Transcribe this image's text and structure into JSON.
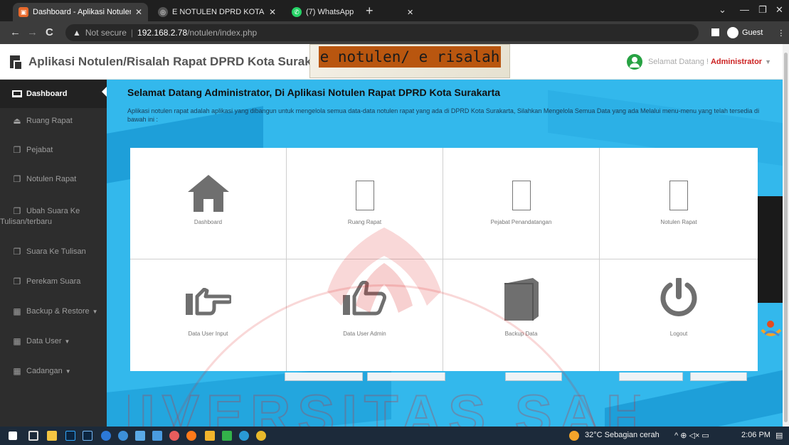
{
  "browser": {
    "tabs": [
      {
        "title": "Dashboard - Aplikasi Notulen Ra",
        "active": true,
        "favicon_color": "#e8692c"
      },
      {
        "title": "E NOTULEN DPRD KOTA SURAKA",
        "active": false,
        "favicon_color": "#8a8a8a"
      },
      {
        "title": "(7) WhatsApp",
        "active": false,
        "favicon_color": "#25d366"
      }
    ],
    "new_tab": "+",
    "address": {
      "security": "Not secure",
      "host": "192.168.2.78",
      "path": "/notulen/index.php"
    },
    "profile_label": "Guest"
  },
  "header": {
    "app_title": "Aplikasi Notulen/Risalah Rapat DPRD Kota Surakarta",
    "banner_text": "e notulen/ e risalah",
    "welcome_prefix": "Selamat Datang !",
    "user_name": "Administrator"
  },
  "sidebar": {
    "items": [
      {
        "label": "Dashboard",
        "icon": "monitor-icon",
        "active": true
      },
      {
        "label": "Ruang Rapat",
        "icon": "hdd-icon"
      },
      {
        "label": "Pejabat",
        "icon": "copy-icon"
      },
      {
        "label": "Notulen Rapat",
        "icon": "copy-icon"
      },
      {
        "label": "Ubah Suara Ke",
        "label2": "Tulisan/terbaru",
        "icon": "copy-icon"
      },
      {
        "label": "Suara Ke Tulisan",
        "icon": "copy-icon"
      },
      {
        "label": "Perekam Suara",
        "icon": "copy-icon"
      },
      {
        "label": "Backup & Restore",
        "icon": "table-icon",
        "dropdown": true
      },
      {
        "label": "Data User",
        "icon": "table-icon",
        "dropdown": true
      },
      {
        "label": "Cadangan",
        "icon": "table-icon",
        "dropdown": true
      }
    ]
  },
  "main": {
    "heading": "Selamat Datang Administrator, Di Aplikasi Notulen Rapat DPRD Kota Surakarta",
    "description": "Aplikasi notulen rapat adalah aplikasi yang dibangun untuk mengelola semua data-data notulen rapat yang ada di DPRD Kota Surakarta, Silahkan Mengelola Semua Data yang ada Melalui menu-menu yang telah tersedia di bawah ini :",
    "tiles": [
      {
        "label": "Dashboard",
        "icon": "home-icon"
      },
      {
        "label": "Ruang Rapat",
        "icon": "missing-glyph-icon"
      },
      {
        "label": "Pejabat Penandatangan",
        "icon": "missing-glyph-icon"
      },
      {
        "label": "Notulen Rapat",
        "icon": "missing-glyph-icon"
      },
      {
        "label": "Data User Input",
        "icon": "hand-point-right-icon"
      },
      {
        "label": "Data User Admin",
        "icon": "thumbs-up-icon"
      },
      {
        "label": "Backup Data",
        "icon": "book-icon"
      },
      {
        "label": "Logout",
        "icon": "power-icon"
      }
    ]
  },
  "taskbar": {
    "weather": "32°C  Sebagian cerah",
    "time": "2:06 PM"
  },
  "watermark": {
    "text": "UNIVERSITAS SAHID"
  },
  "colors": {
    "sidebar_bg": "#2d2d2d",
    "content_bg": "#33b8ec",
    "user_name": "#cc2222",
    "banner": "#b9560f"
  }
}
